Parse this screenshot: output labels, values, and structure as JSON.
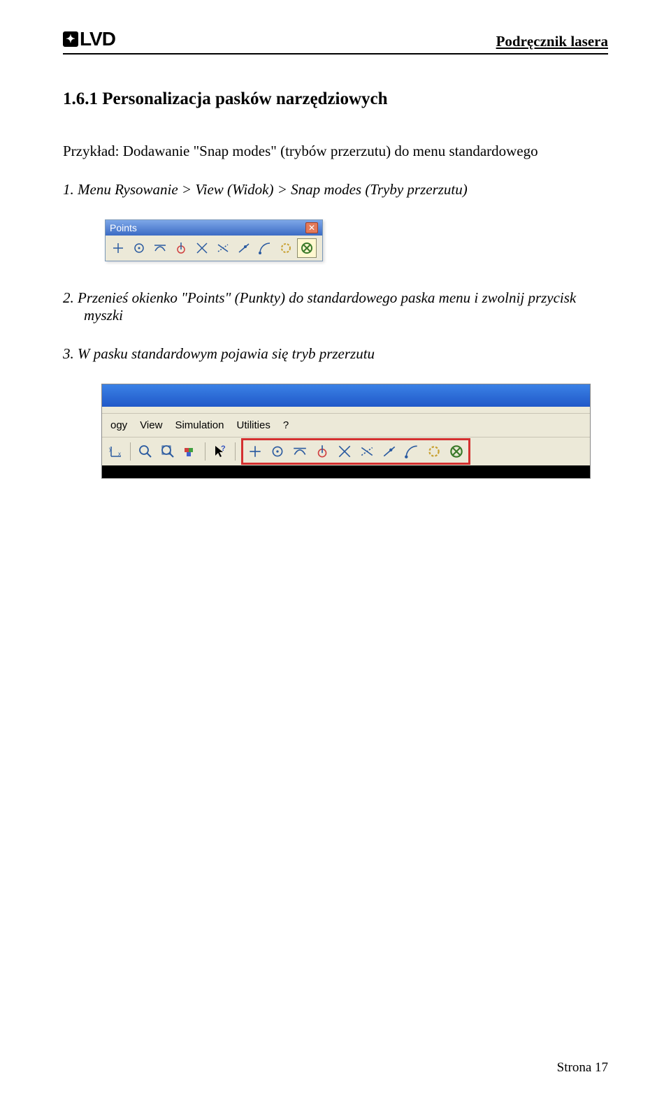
{
  "header": {
    "logo_text": "LVD",
    "doc_title": "Podręcznik lasera"
  },
  "section": {
    "number": "1.6.1",
    "heading": "1.6.1 Personalizacja pasków narzędziowych",
    "intro": "Przykład: Dodawanie   \"Snap modes\" (trybów przerzutu) do menu standardowego",
    "step1": "1. Menu Rysowanie  > View (Widok) > Snap modes (Tryby przerzutu)",
    "step2_line1": "2.  Przenieś okienko \"Points\" (Punkty) do standardowego paska menu i zwolnij przycisk",
    "step2_line2": "myszki",
    "step3": "3.  W pasku standardowym pojawia się tryb przerzutu"
  },
  "points_window": {
    "title": "Points",
    "icons": [
      "snap-endpoint",
      "snap-center",
      "snap-tangent",
      "snap-perpendicular",
      "snap-intersection",
      "snap-apparent",
      "snap-nearest",
      "snap-quadrant",
      "snap-node",
      "snap-none"
    ]
  },
  "menubar": {
    "items": [
      "ogy",
      "View",
      "Simulation",
      "Utilities",
      "?"
    ],
    "snap_icons": [
      "snap-endpoint",
      "snap-center",
      "snap-tangent",
      "snap-perpendicular",
      "snap-intersection",
      "snap-apparent",
      "snap-nearest",
      "snap-quadrant",
      "snap-node",
      "snap-none"
    ]
  },
  "footer": {
    "page_label": "Strona 17"
  }
}
